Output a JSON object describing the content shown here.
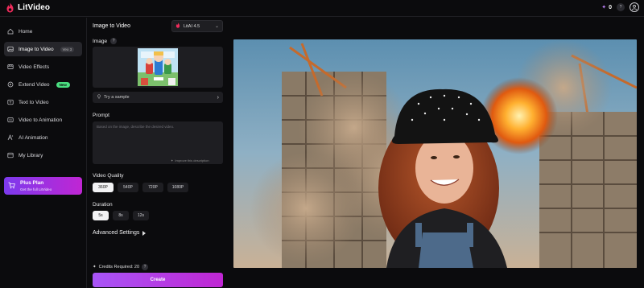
{
  "app": {
    "name": "LitVideo"
  },
  "header": {
    "credits": "0",
    "help_icon": "?"
  },
  "sidebar": {
    "items": [
      {
        "label": "Home",
        "icon": "home-icon"
      },
      {
        "label": "Image to Video",
        "icon": "image-video-icon",
        "badge": "Veo 3",
        "active": true
      },
      {
        "label": "Video Effects",
        "icon": "effects-icon"
      },
      {
        "label": "Extend Video",
        "icon": "extend-icon",
        "badge": "New"
      },
      {
        "label": "Text to Video",
        "icon": "text-video-icon"
      },
      {
        "label": "Video to Animation",
        "icon": "animation-icon"
      },
      {
        "label": "AI Animation",
        "icon": "ai-animation-icon"
      },
      {
        "label": "My Library",
        "icon": "library-icon"
      }
    ],
    "plan": {
      "title": "Plus Plan",
      "subtitle": "Get the full LitVideo"
    }
  },
  "panel": {
    "title": "Image to Video",
    "model": "LitAI 4.5",
    "image_label": "Image",
    "sample_label": "Try a sample",
    "prompt_label": "Prompt",
    "prompt_placeholder": "Based on the image, describe the desired video.",
    "improve_label": "Improve this description",
    "quality_label": "Video Quality",
    "quality_options": [
      "360P",
      "540P",
      "720P",
      "1080P"
    ],
    "quality_selected": "360P",
    "duration_label": "Duration",
    "duration_options": [
      "5s",
      "8s",
      "12s"
    ],
    "duration_selected": "5s",
    "advanced_label": "Advanced Settings",
    "credits_label": "Credits Required: 20",
    "create_label": "Create"
  },
  "colors": {
    "accent_start": "#a855f7",
    "accent_end": "#c026d3",
    "new_badge": "#4ade80",
    "background": "#0b0b0d"
  }
}
